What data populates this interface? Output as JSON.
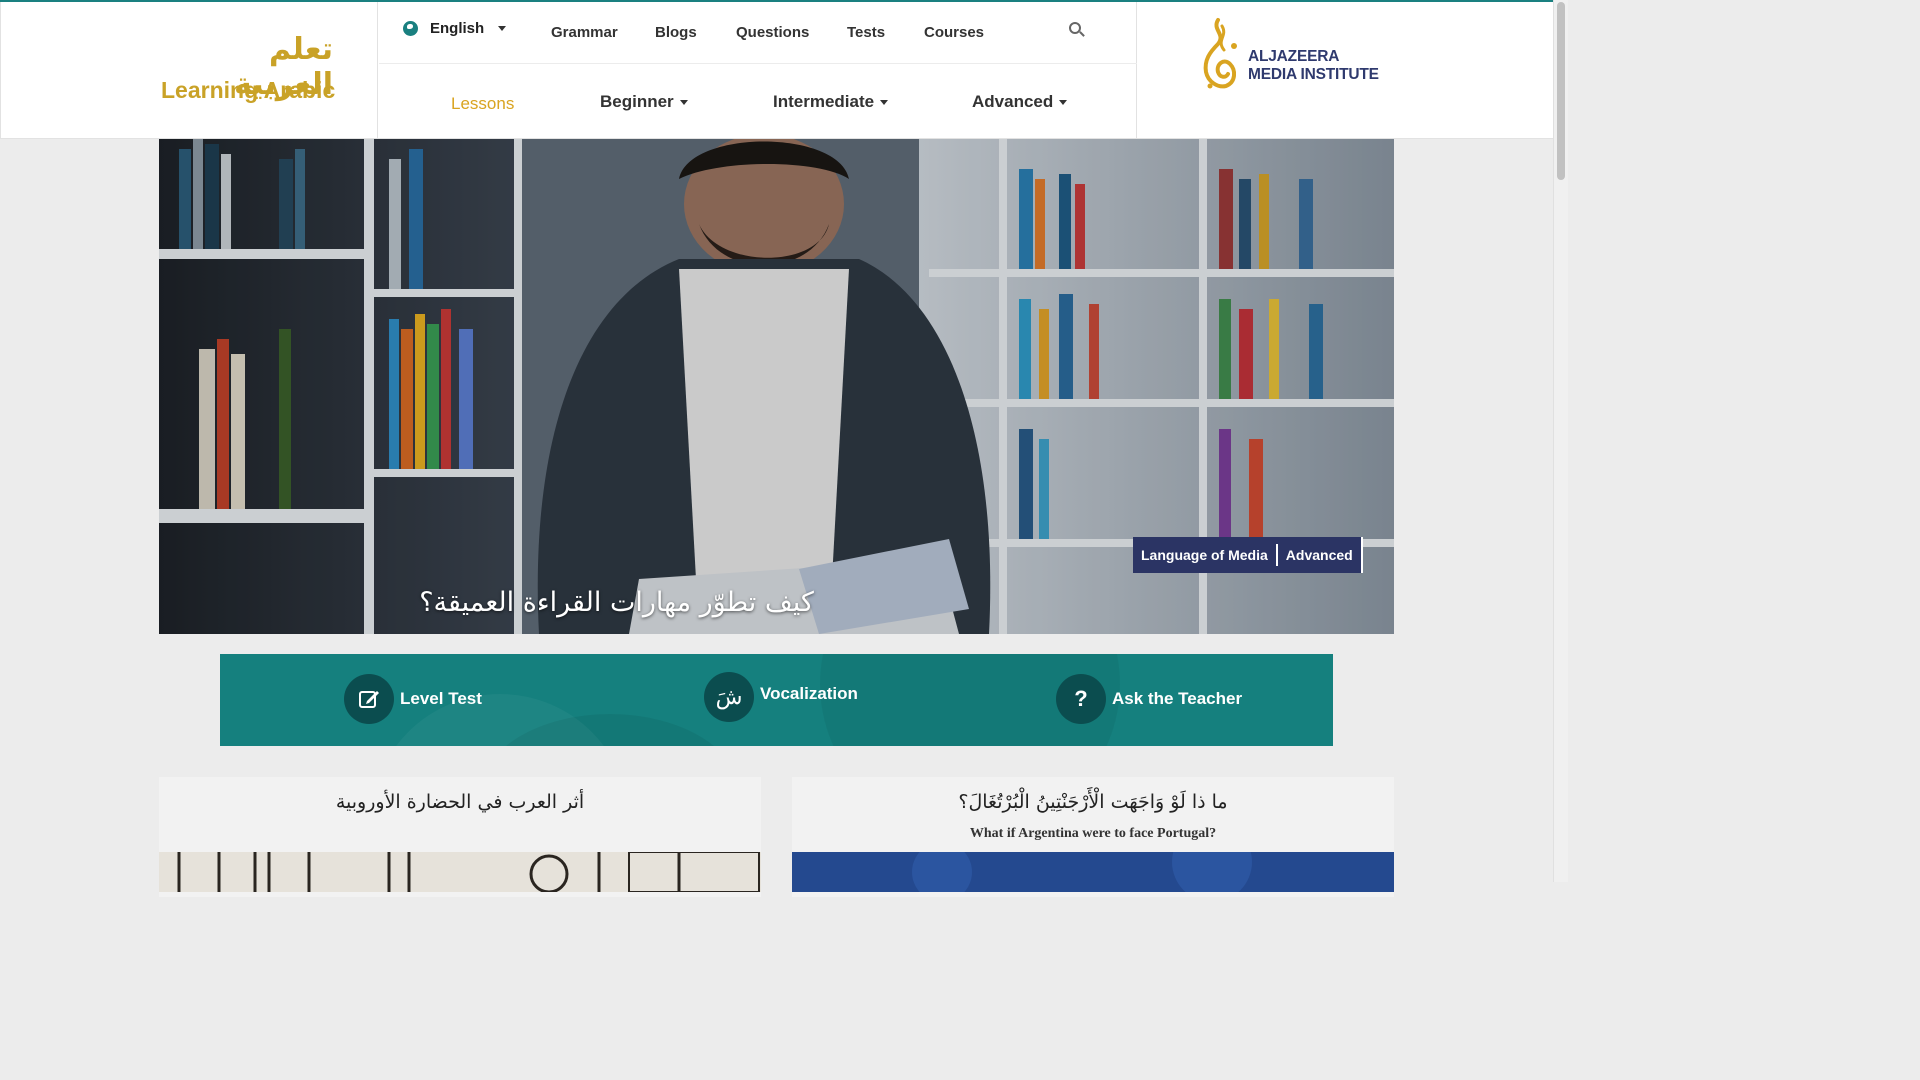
{
  "brand": {
    "arabic": "تعلم العربية",
    "english": "Learning Arabic"
  },
  "nav": {
    "language": "English",
    "top_items": [
      "Grammar",
      "Blogs",
      "Questions",
      "Tests",
      "Courses"
    ],
    "sub_items": [
      "Lessons",
      "Beginner",
      "Intermediate",
      "Advanced"
    ],
    "active_sub": "Lessons"
  },
  "logo": {
    "line1": "ALJAZEERA",
    "line2": "MEDIA INSTITUTE"
  },
  "hero": {
    "title": "كيف تطوّر مهارات القراءة العميقة؟",
    "tags": [
      "Language of Media",
      "Advanced"
    ]
  },
  "tools": [
    {
      "label": "Level Test",
      "icon": "edit-icon"
    },
    {
      "label": "Vocalization",
      "icon": "vocalization-icon",
      "glyph": "شَ"
    },
    {
      "label": "Ask the Teacher",
      "icon": "question-icon",
      "glyph": "?"
    }
  ],
  "cards": [
    {
      "title_ar": "أثر العرب في الحضارة الأوروبية"
    },
    {
      "title_ar": "ما ذا لَوْ وَاجَهَت الْأَرْجَنْتِينُ الْبُرْتُغَالَ؟",
      "title_en": "What if Argentina were to face Portugal?"
    }
  ],
  "colors": {
    "accent": "#15807e",
    "brand_gold": "#c9a227",
    "tag_bg": "#2b3464",
    "active_nav": "#d9a421"
  }
}
